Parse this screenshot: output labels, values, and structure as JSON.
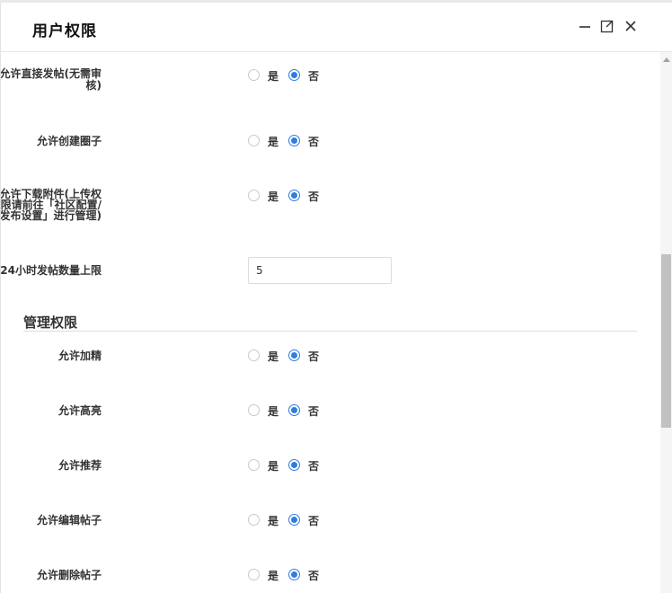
{
  "dialog": {
    "title": "用户权限",
    "controls": {
      "minimize": "minimize-icon",
      "maximize": "maximize-icon",
      "close": "close-icon"
    }
  },
  "radio_labels": {
    "yes": "是",
    "no": "否"
  },
  "colors": {
    "accent": "#2f7de1"
  },
  "rows": [
    {
      "label_lines": [
        "允许直接发帖(无需审",
        "核)"
      ],
      "selected": "否"
    },
    {
      "label_lines": [
        "允许创建圈子"
      ],
      "selected": "否"
    },
    {
      "label_lines": [
        "允许下载附件(上传权",
        "限请前往「社区配置/",
        "发布设置」进行管理)"
      ],
      "selected": "否"
    }
  ],
  "post_limit": {
    "label": "24小时发帖数量上限",
    "value": "5"
  },
  "manage_section": {
    "title": "管理权限",
    "rows": [
      {
        "label": "允许加精",
        "selected": "否"
      },
      {
        "label": "允许高亮",
        "selected": "否"
      },
      {
        "label": "允许推荐",
        "selected": "否"
      },
      {
        "label": "允许编辑帖子",
        "selected": "否"
      },
      {
        "label": "允许删除帖子",
        "selected": "否"
      }
    ]
  }
}
